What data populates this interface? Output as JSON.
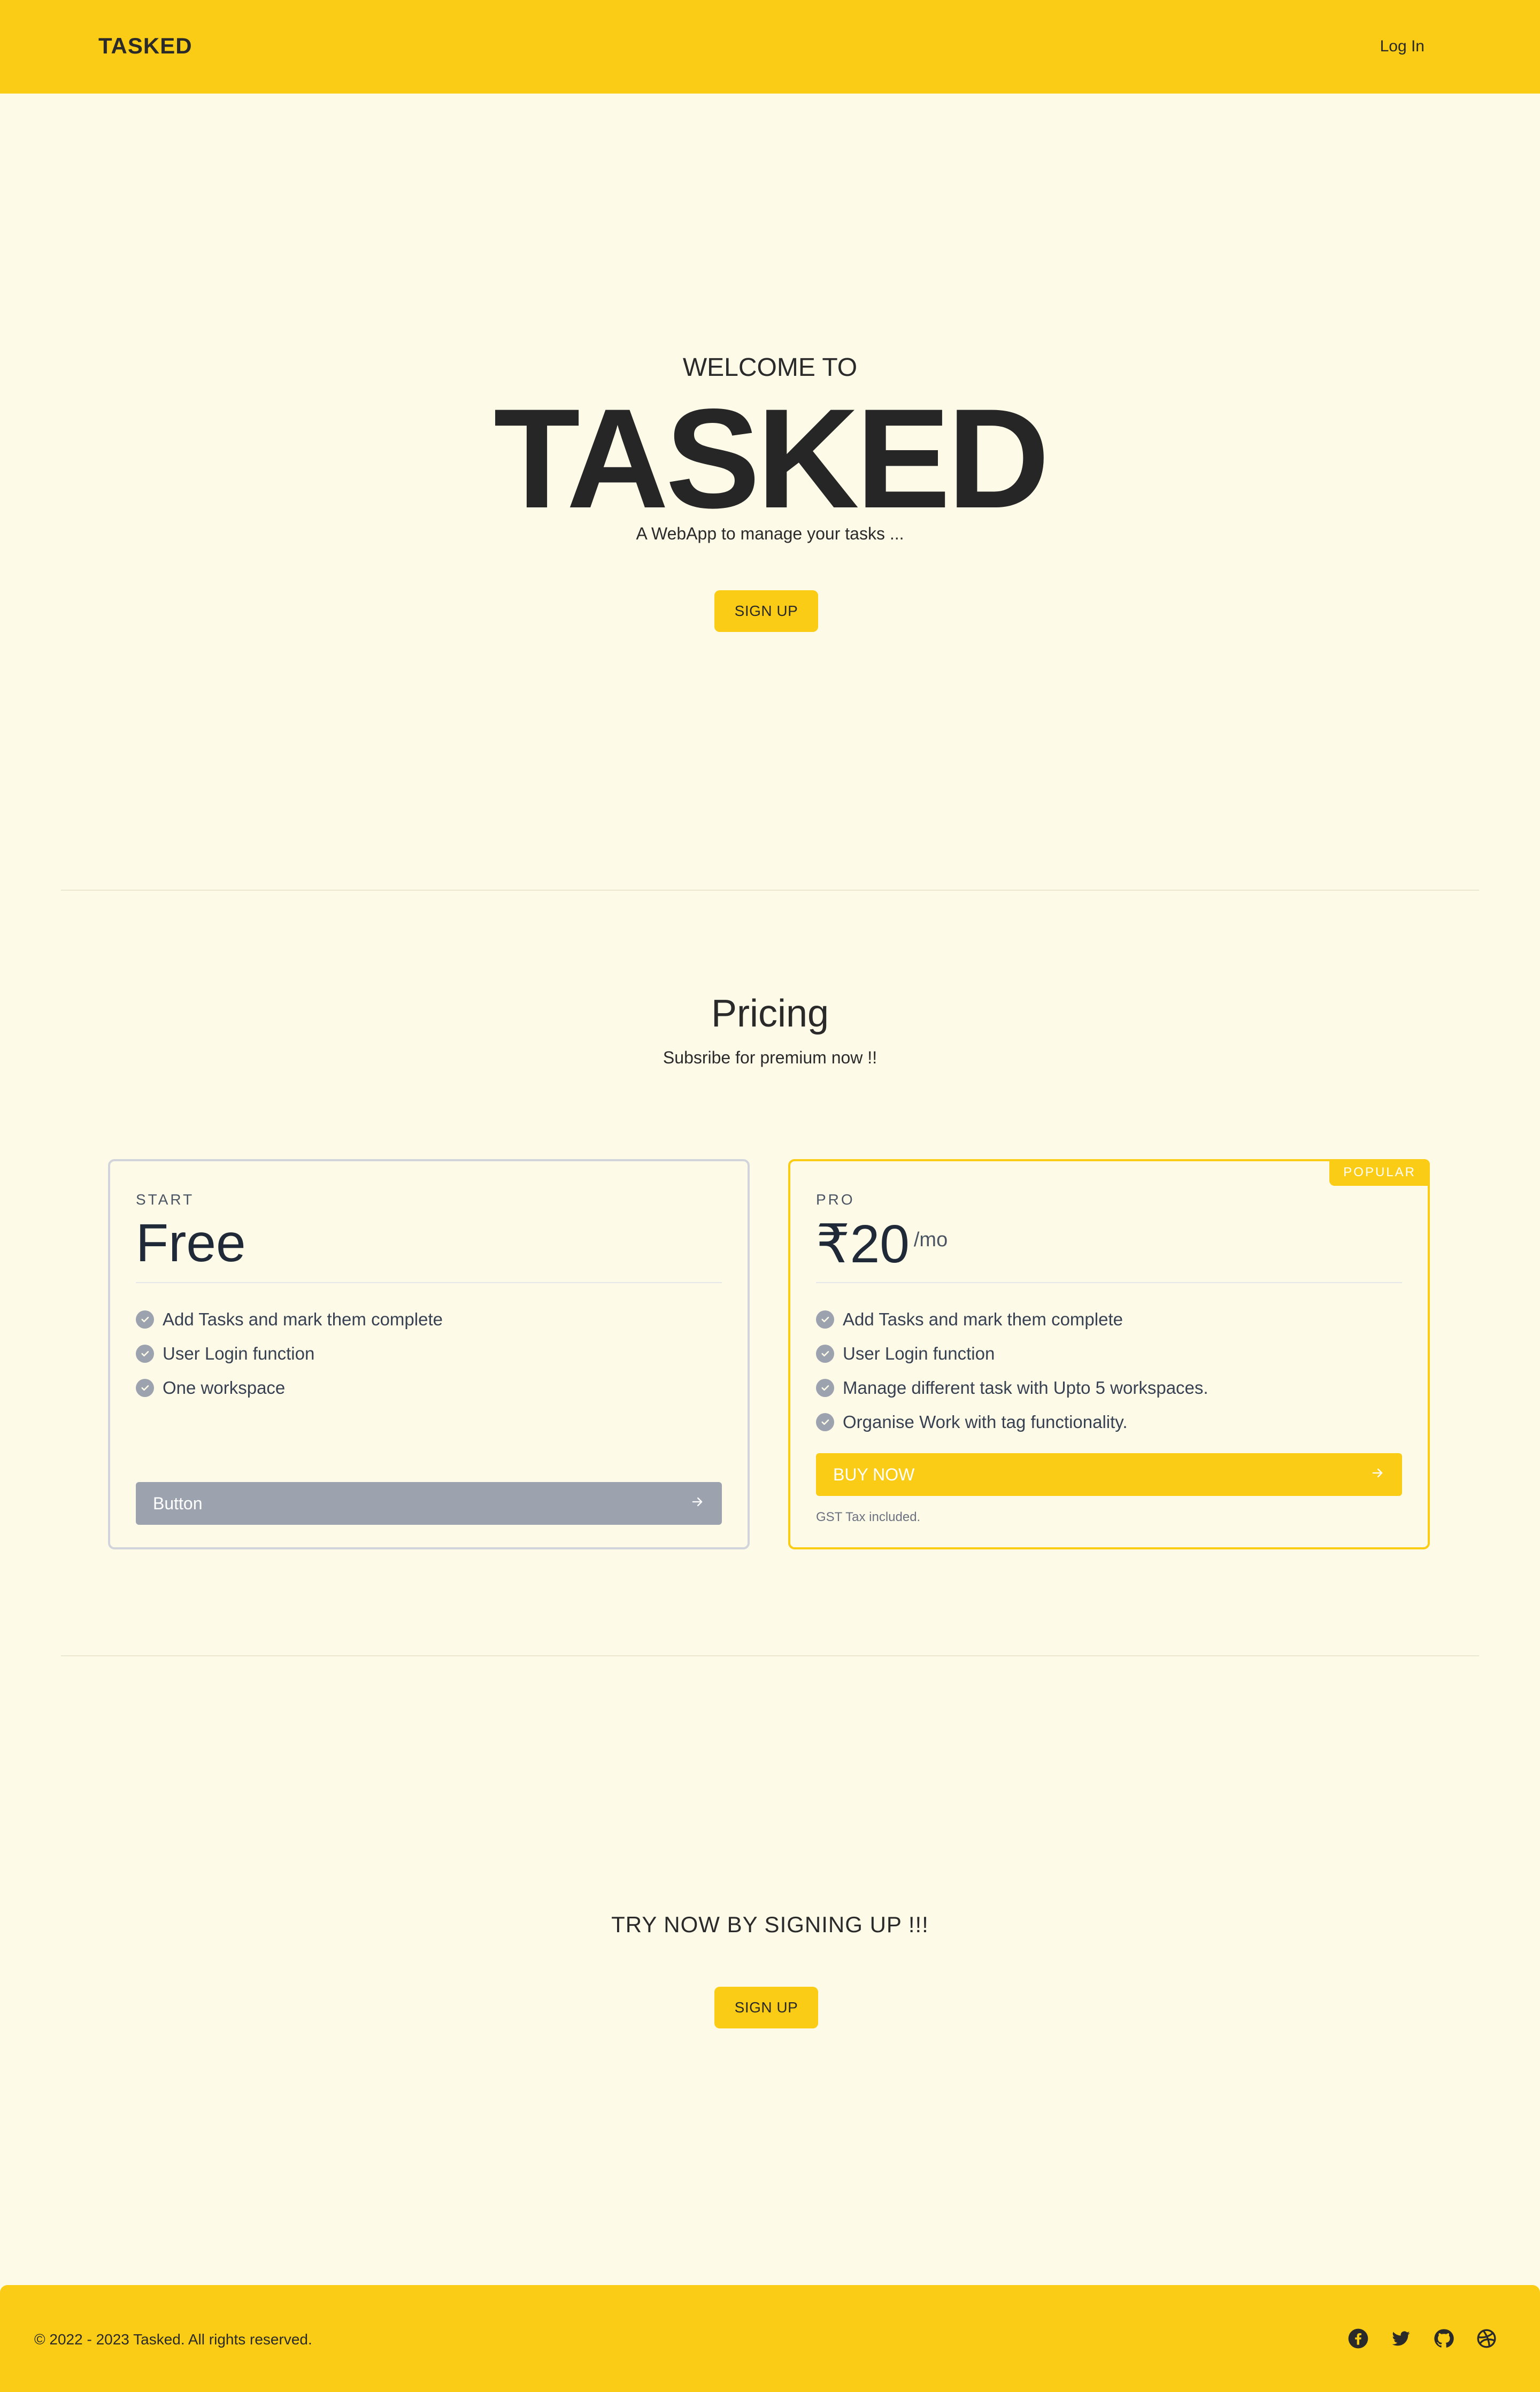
{
  "header": {
    "brand": "TASKED",
    "login": "Log In"
  },
  "hero": {
    "welcome": "WELCOME TO",
    "title": "TASKED",
    "tagline": "A WebApp to manage your tasks ...",
    "signup": "SIGN UP"
  },
  "pricing": {
    "title": "Pricing",
    "subtitle": "Subsribe for premium now !!",
    "plans": [
      {
        "tier": "START",
        "price": "Free",
        "features": [
          "Add Tasks and mark them complete",
          "User Login function",
          "One workspace"
        ],
        "button": "Button"
      },
      {
        "tier": "PRO",
        "price": "₹20",
        "period": "/mo",
        "badge": "POPULAR",
        "features": [
          "Add Tasks and mark them complete",
          "User Login function",
          "Manage different task with Upto 5 workspaces.",
          "Organise Work with tag functionality."
        ],
        "button": "BUY NOW",
        "note": "GST Tax included."
      }
    ]
  },
  "cta": {
    "text": "TRY NOW BY SIGNING UP !!!",
    "signup": "SIGN UP"
  },
  "footer": {
    "copyright": "© 2022 - 2023 Tasked. All rights reserved.",
    "social_icons": [
      "facebook-icon",
      "twitter-icon",
      "github-icon",
      "dribbble-icon"
    ]
  },
  "colors": {
    "accent": "#facc15",
    "background": "#fefae8",
    "muted_button": "#9ca3af"
  }
}
